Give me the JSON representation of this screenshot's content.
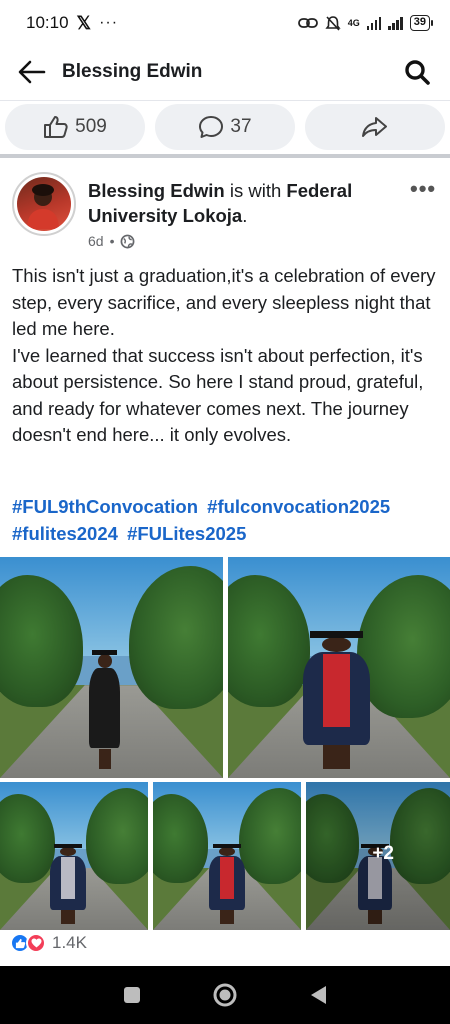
{
  "status_bar": {
    "time": "10:10",
    "x_label": "𝕏",
    "overflow": "···",
    "network": "4G",
    "battery": "39"
  },
  "header": {
    "title": "Blessing Edwin"
  },
  "actions": {
    "likes": "509",
    "comments": "37"
  },
  "post": {
    "author": "Blessing Edwin",
    "with_text": " is with ",
    "location": "Federal University Lokoja",
    "location_suffix": ".",
    "time": "6d",
    "separator": "•",
    "more": "•••",
    "body_line1": "This isn't just a graduation,it's a celebration of every step, every sacrifice, and every sleepless night that led me here.",
    "body_line2": "I've learned that success isn't about perfection, it's about persistence. So here I stand proud, grateful, and ready for whatever comes next. The journey doesn't end here... it only evolves.",
    "hashtags": [
      "#FUL9thConvocation",
      "#fulconvocation2025",
      "#fulites2024",
      "#FULites2025"
    ],
    "more_photos": "+2",
    "reaction_count": "1.4K"
  },
  "icons": {
    "back": "arrow-left-icon",
    "search": "search-icon",
    "like": "thumbs-up-icon",
    "comment": "comment-icon",
    "share": "share-icon",
    "globe": "globe-icon"
  },
  "colors": {
    "hashtag": "#1a66c9",
    "like_reaction": "#1877f2",
    "love_reaction": "#f33e58"
  }
}
